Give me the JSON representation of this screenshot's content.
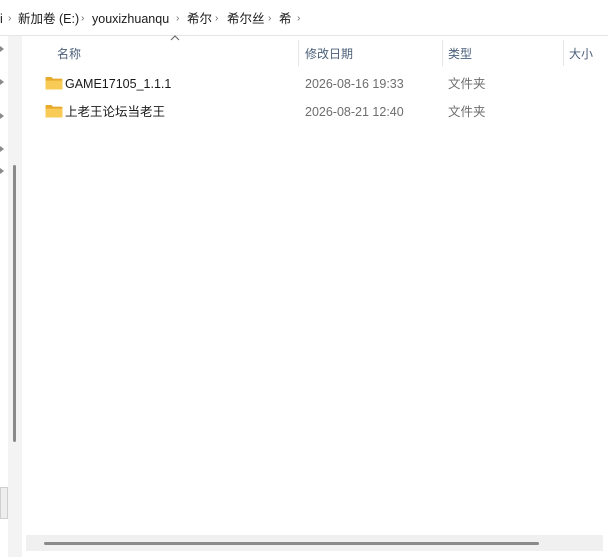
{
  "breadcrumb": {
    "items": [
      "i",
      "新加卷 (E:)",
      "youxizhuanqu",
      "希尔",
      "希尔丝",
      "希"
    ],
    "separator": "›"
  },
  "columns": {
    "name": "名称",
    "date": "修改日期",
    "type": "类型",
    "size": "大小"
  },
  "files": [
    {
      "name": "GAME17105_1.1.1",
      "date": "2026-08-16 19:33",
      "type": "文件夹",
      "icon": "folder-icon"
    },
    {
      "name": "上老王论坛当老王",
      "date": "2026-08-21 12:40",
      "type": "文件夹",
      "icon": "folder-icon"
    }
  ],
  "colors": {
    "folder": "#f2c14e",
    "header_text": "#4c607a",
    "meta_text": "#6d6d6d"
  }
}
